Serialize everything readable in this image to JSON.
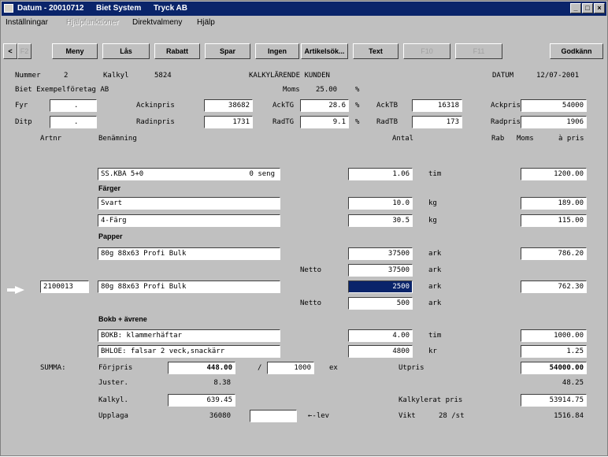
{
  "window": {
    "title_parts": [
      "Datum - 20010712",
      "Biet System",
      "Tryck AB"
    ],
    "buttons": [
      "_",
      "□",
      "×"
    ]
  },
  "menu": {
    "items": [
      "Inställningar",
      "Hjälpfunktioner",
      "Direktvalmeny",
      "Hjälp"
    ]
  },
  "toolbar": {
    "keys": [
      "<",
      "F2",
      "Meny",
      "Lås",
      "Rabatt",
      "Spar",
      "Ingen",
      "Artikelsök...",
      "Text",
      "F10",
      "F11",
      "Godkänn"
    ]
  },
  "header": {
    "nummer_label": "Nummer",
    "nummer_value": "2",
    "kalkyl_label": "Kalkyl",
    "kalkyl_value": "5824",
    "doc_title": "KALKYLÄRENDE KUNDEN",
    "datum_label": "DATUM",
    "datum_value": "12/07-2001",
    "company": "Biet Exempelföretag AB",
    "moms_label": "Moms",
    "moms_value": "25.00",
    "percent": "%"
  },
  "price_rows": {
    "fyr_label": "Fyr",
    "ditp_label": "Ditp",
    "sep_value": ".",
    "ackinpris_label": "Ackinpris",
    "ackinpris_value": "38682",
    "radinpris_label": "Radinpris",
    "radinpris_value": "1731",
    "acktg_label": "AckTG",
    "acktg_value": "28.6",
    "radtg_label": "RadTG",
    "radtg_value": "9.1",
    "acktb_label": "AckTB",
    "acktb_value": "16318",
    "radtb_label": "RadTB",
    "radtb_value": "173",
    "ackpris_label": "Ackpris",
    "ackpris_value": "54000",
    "radpris_label": "Radpris",
    "radpris_value": "1906"
  },
  "columns": {
    "artnr": "Artnr",
    "benamning": "Benämning",
    "antal": "Antal",
    "rab": "Rab",
    "moms": "Moms",
    "apris": "à pris"
  },
  "lines": {
    "row1_desc": "SS.KBA 5+0",
    "row1_note": "0 seng",
    "row1_antal": "1.06",
    "row1_unit": "tim",
    "row1_price": "1200.00",
    "farger_heading": "Färger",
    "svart": "Svart",
    "svart_antal": "10.0",
    "svart_unit": "kg",
    "svart_price": "189.00",
    "fyrfarg": "4-Färg",
    "fyrfarg_antal": "30.5",
    "fyrfarg_unit": "kg",
    "fyrfarg_price": "115.00",
    "papper_heading": "Papper",
    "papper1": "80g 88x63 Profi Bulk",
    "papper1_antal": "37500",
    "papper1_unit": "ark",
    "papper1_price": "786.20",
    "netto_label": "Netto",
    "netto1_value": "37500",
    "netto1_unit": "ark",
    "artnr_value": "2100013",
    "papper2": "80g 88x63 Profi Bulk",
    "papper2_antal": "2500",
    "papper2_unit": "ark",
    "papper2_price": "762.30",
    "netto2_value": "500",
    "netto2_unit": "ark",
    "bokb_heading": "Bokb + ävrene",
    "bokb1": "BOKB: klammerhäftar",
    "bokb1_antal": "4.00",
    "bokb1_unit": "tim",
    "bokb1_price": "1000.00",
    "bokb2": "BHLOE: falsar 2 veck,snackärr",
    "bokb2_antal": "4800",
    "bokb2_unit": "kr",
    "bokb2_price": "1.25"
  },
  "summary": {
    "summa_label": "SUMMA:",
    "forjpris_label": "Förjpris",
    "forjpris_value": "448.00",
    "slash": "/",
    "per_value": "1000",
    "per_unit": "ex",
    "utpris_label": "Utpris",
    "utpris_value": "54000.00",
    "juster_label": "Juster.",
    "juster_value": "8.38",
    "juster_right": "48.25",
    "kalkyl_label": "Kalkyl.",
    "kalkyl_value": "639.45",
    "kalkylerat_label": "Kalkylerat pris",
    "kalkylerat_value": "53914.75",
    "upplaga_label": "Upplaga",
    "upplaga_value": "36080",
    "lev_label": "←-lev",
    "vikt_label": "Vikt",
    "vikt_value": "28 /st",
    "vikt_total": "1516.84"
  }
}
